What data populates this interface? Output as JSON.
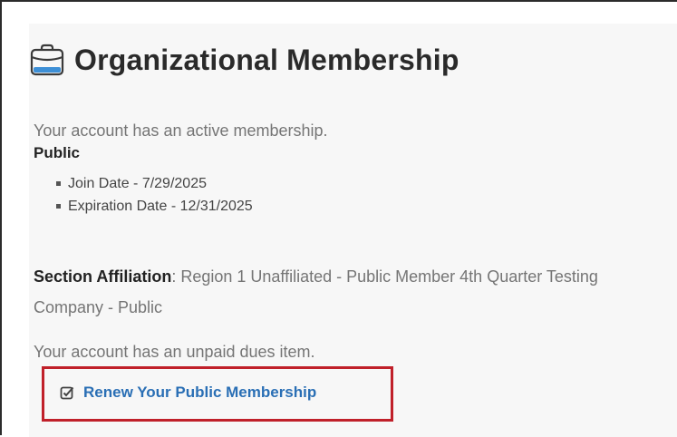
{
  "membership": {
    "title": "Organizational Membership",
    "status_text": "Your account has an active membership.",
    "plan_name": "Public",
    "dates": [
      "Join Date - 7/29/2025",
      "Expiration Date - 12/31/2025"
    ],
    "section_affiliation_label": "Section Affiliation",
    "section_affiliation_value": ": Region 1 Unaffiliated - Public Member 4th Quarter Testing Company - Public",
    "dues_text": "Your account has an unpaid dues item.",
    "renew_link_label": "Renew Your Public Membership"
  },
  "icons": {
    "heading_icon": "briefcase-icon",
    "renew_icon": "checkbox-edit-icon"
  },
  "colors": {
    "link": "#2a6fb5",
    "highlight_border": "#c0202a",
    "card_background": "#f7f7f7",
    "icon_accent": "#3d8fd6"
  }
}
